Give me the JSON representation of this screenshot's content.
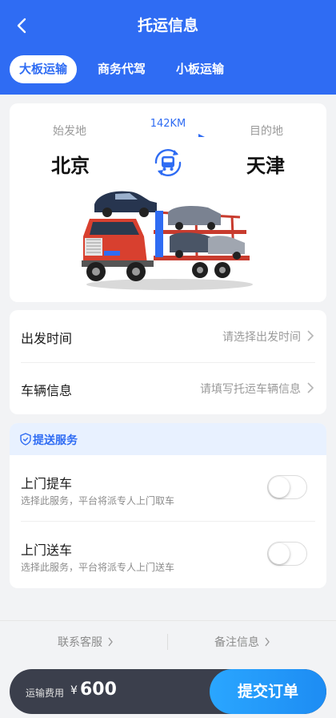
{
  "header": {
    "title": "托运信息",
    "tabs": [
      {
        "label": "大板运输",
        "active": true
      },
      {
        "label": "商务代驾",
        "active": false
      },
      {
        "label": "小板运输",
        "active": false
      }
    ]
  },
  "route": {
    "from_label": "始发地",
    "from_city": "北京",
    "to_label": "目的地",
    "to_city": "天津",
    "distance": "142KM"
  },
  "info": {
    "departure_label": "出发时间",
    "departure_placeholder": "请选择出发时间",
    "vehicle_label": "车辆信息",
    "vehicle_placeholder": "请填写托运车辆信息"
  },
  "service": {
    "title": "提送服务",
    "items": [
      {
        "title": "上门提车",
        "desc": "选择此服务，平台将派专人上门取车",
        "enabled": false
      },
      {
        "title": "上门送车",
        "desc": "选择此服务，平台将派专人上门送车",
        "enabled": false
      }
    ]
  },
  "links": {
    "contact": "联系客服",
    "notes": "备注信息"
  },
  "footer": {
    "fee_label": "运输费用",
    "currency": "¥",
    "amount": "600",
    "submit": "提交订单"
  },
  "colors": {
    "primary": "#2f6cf3",
    "submit": "#1d8cf3",
    "bottom_bar": "#3b3f4c"
  }
}
